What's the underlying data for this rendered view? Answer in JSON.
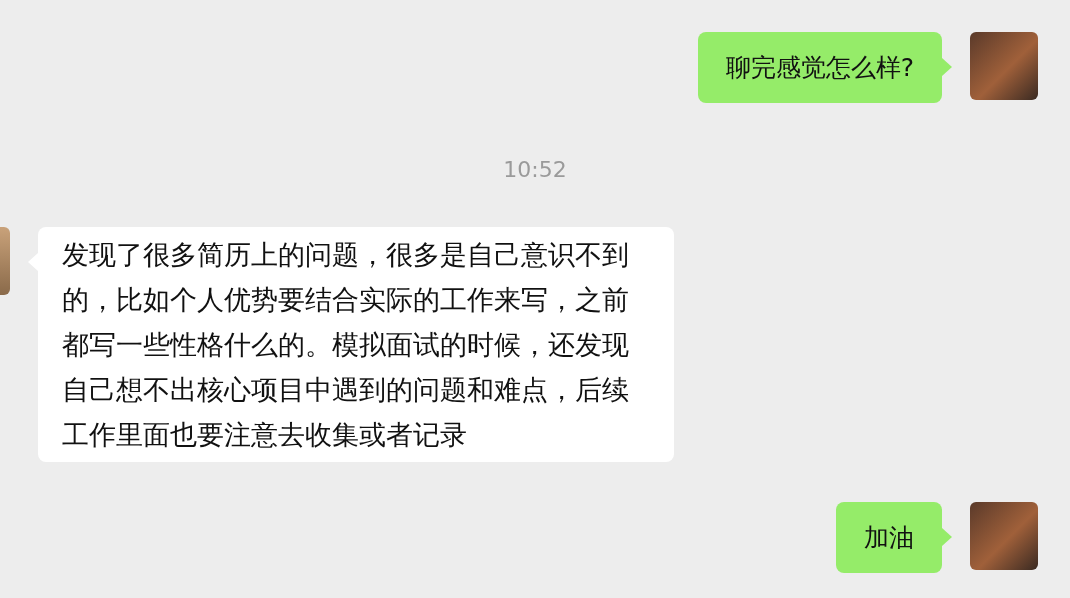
{
  "messages": [
    {
      "kind": "text",
      "outgoing": true,
      "text": "聊完感觉怎么样?"
    },
    {
      "kind": "time",
      "text": "10:52"
    },
    {
      "kind": "text",
      "outgoing": false,
      "text": "发现了很多简历上的问题，很多是自己意识不到的，比如个人优势要结合实际的工作来写，之前都写一些性格什么的。模拟面试的时候，还发现自己想不出核心项目中遇到的问题和难点，后续工作里面也要注意去收集或者记录"
    },
    {
      "kind": "text",
      "outgoing": true,
      "text": "加油"
    }
  ]
}
